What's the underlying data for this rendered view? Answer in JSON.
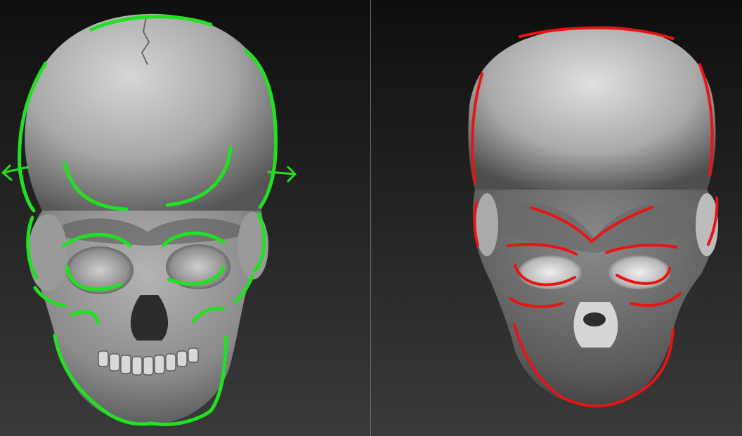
{
  "panels": [
    {
      "name": "left-viewport",
      "subject": "detailed-skull-sculpt",
      "annotation_color": "#22e022"
    },
    {
      "name": "right-viewport",
      "subject": "blocked-out-skull-sculpt",
      "annotation_color": "#e81414"
    }
  ],
  "colors": {
    "background_top": "#0e0e0e",
    "background_bottom": "#3a3a3a",
    "divider": "#6e6e6e",
    "clay_light": "#dedede",
    "clay_dark": "#3c3c3c"
  }
}
